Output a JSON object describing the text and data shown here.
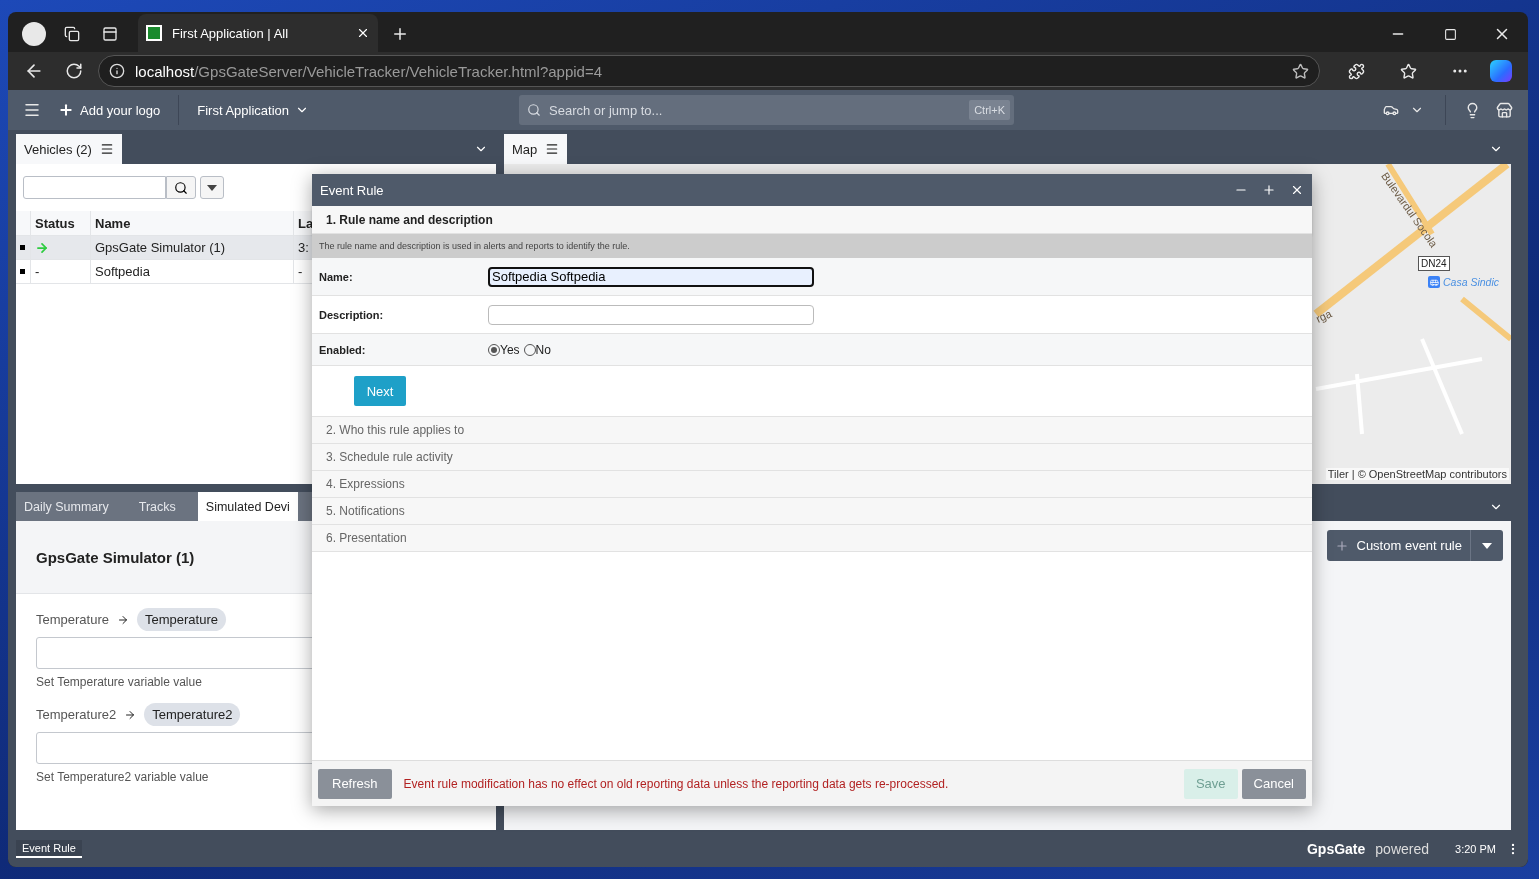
{
  "browser": {
    "tab_title": "First Application | All",
    "url_host": "localhost",
    "url_path": "/GpsGateServer/VehicleTracker/VehicleTracker.html?appid=4"
  },
  "app_header": {
    "logo_button": "Add your logo",
    "app_menu": "First Application",
    "search": {
      "placeholder": "Search or jump to...",
      "shortcut": "Ctrl+K"
    }
  },
  "vehicles_panel": {
    "tab": "Vehicles (2)",
    "columns": [
      "Status",
      "Name",
      "La"
    ],
    "rows": [
      {
        "selected": true,
        "status": {
          "kind": "arrow"
        },
        "name": "GpsGate Simulator (1)",
        "column_3": "3:"
      },
      {
        "selected": false,
        "status": {
          "kind": "text",
          "text": "-"
        },
        "name": "Softpedia",
        "column_3": "-"
      }
    ]
  },
  "bottom_tabs": [
    {
      "label": "Daily Summary",
      "selected": false
    },
    {
      "label": "Tracks",
      "selected": false
    },
    {
      "label": "Simulated Devi",
      "selected": true
    }
  ],
  "simulator": {
    "title": "GpsGate Simulator (1)",
    "variables": [
      {
        "label": "Temperature",
        "chip": "Temperature",
        "hint": "Set Temperature variable value"
      },
      {
        "label": "Temperature2",
        "chip": "Temperature2",
        "hint": "Set Temperature2 variable value"
      }
    ]
  },
  "map_panel": {
    "tab": "Map",
    "road_label": "Bulevardul Socola",
    "road_label_2": "rga",
    "shield": "DN24",
    "poi": "Casa Sindic",
    "attribution": "Tiler | © OpenStreetMap contributors"
  },
  "event_rules_panel": {
    "button": "Custom event rule"
  },
  "dialog": {
    "title": "Event Rule",
    "steps": [
      {
        "label": "1. Rule name and description",
        "expanded": true
      },
      {
        "label": "2. Who this rule applies to",
        "expanded": false
      },
      {
        "label": "3. Schedule rule activity",
        "expanded": false
      },
      {
        "label": "4. Expressions",
        "expanded": false
      },
      {
        "label": "5. Notifications",
        "expanded": false
      },
      {
        "label": "6. Presentation",
        "expanded": false
      }
    ],
    "hint": "The rule name and description is used in alerts and reports to identify the rule.",
    "name_label": "Name:",
    "name_value": "Softpedia Softpedia",
    "description_label": "Description:",
    "enabled_label": "Enabled:",
    "enabled_options": [
      {
        "label": "Yes",
        "selected": true
      },
      {
        "label": "No",
        "selected": false
      }
    ],
    "next": "Next",
    "refresh": "Refresh",
    "message": "Event rule modification has no effect on old reporting data unless the reporting data gets re-processed.",
    "save": {
      "label": "Save",
      "disabled": true
    },
    "cancel": "Cancel"
  },
  "status_bar": {
    "tab": "Event Rule",
    "brand": "GpsGate",
    "powered": "powered",
    "time": "3:20 PM"
  }
}
